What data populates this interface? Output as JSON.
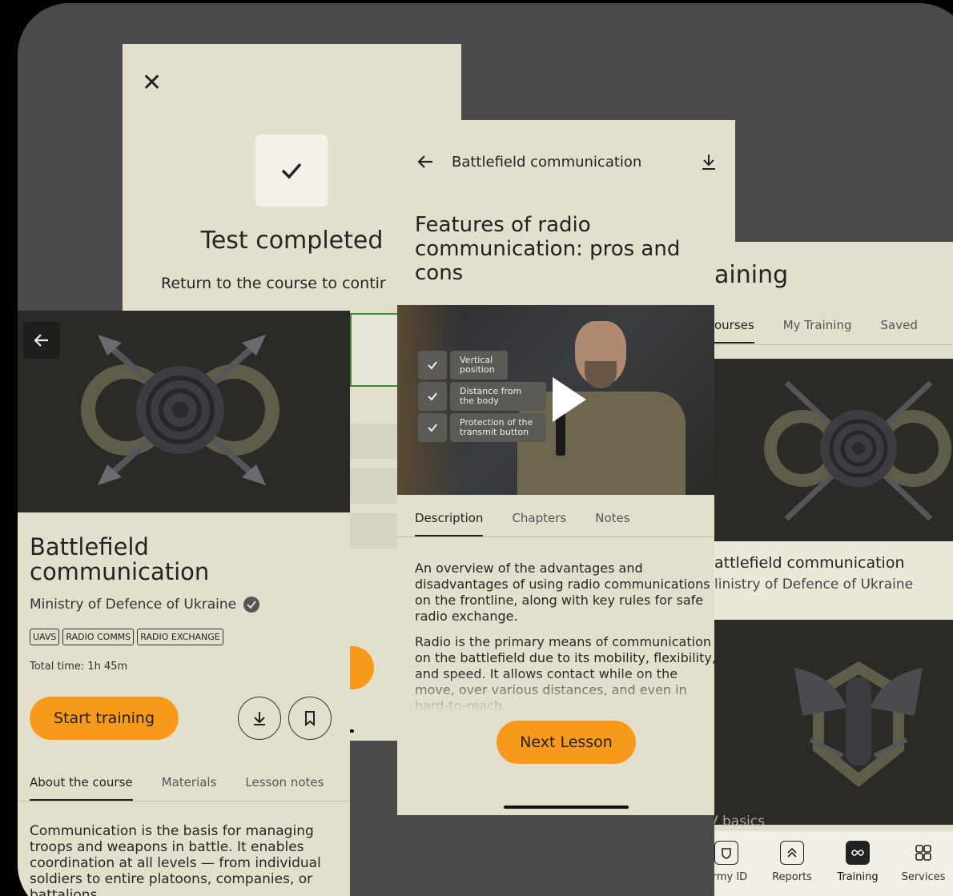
{
  "test": {
    "close": "✕",
    "title": "Test completed",
    "subtitle": "Return to the course to contir"
  },
  "course": {
    "title": "Battlefield communication",
    "org": "Ministry of Defence of Ukraine",
    "tags": [
      "UAVS",
      "RADIO COMMS",
      "RADIO EXCHANGE"
    ],
    "total_time": "Total time: 1h 45m",
    "start_label": "Start training",
    "tabs": [
      "About the course",
      "Materials",
      "Lesson notes"
    ],
    "body": "Communication is the basis for managing troops and weapons in battle. It enables coordination at all levels — from individual soldiers to entire platoons, companies, or battalions."
  },
  "lesson": {
    "topbar_title": "Battlefield communication",
    "title": "Features of radio communication: pros and cons",
    "video_checks": [
      "Vertical position",
      "Distance from the body",
      "Protection of the transmit button"
    ],
    "tabs": [
      "Description",
      "Chapters",
      "Notes"
    ],
    "desc_p1": "An overview of the advantages and disadvantages of using radio communications on the frontline, along with key rules for safe radio exchange.",
    "desc_p2": "Radio is the primary means of communication on the battlefield due to its mobility, flexibility, and speed. It allows contact while on the move, over various distances, and even in hard-to-reach",
    "next_label": "Next Lesson"
  },
  "training": {
    "heading": "aining",
    "tabs": [
      "ourses",
      "My Training",
      "Saved"
    ],
    "card1_title": "attlefield communication",
    "card1_org": "linistry of Defence of Ukraine",
    "card2_title": "UAV basics",
    "nav": [
      "Army ID",
      "Reports",
      "Training",
      "Services"
    ]
  },
  "colors": {
    "accent": "#f79a1c",
    "bg": "#e2dfcd",
    "dark": "#2b2a27"
  }
}
